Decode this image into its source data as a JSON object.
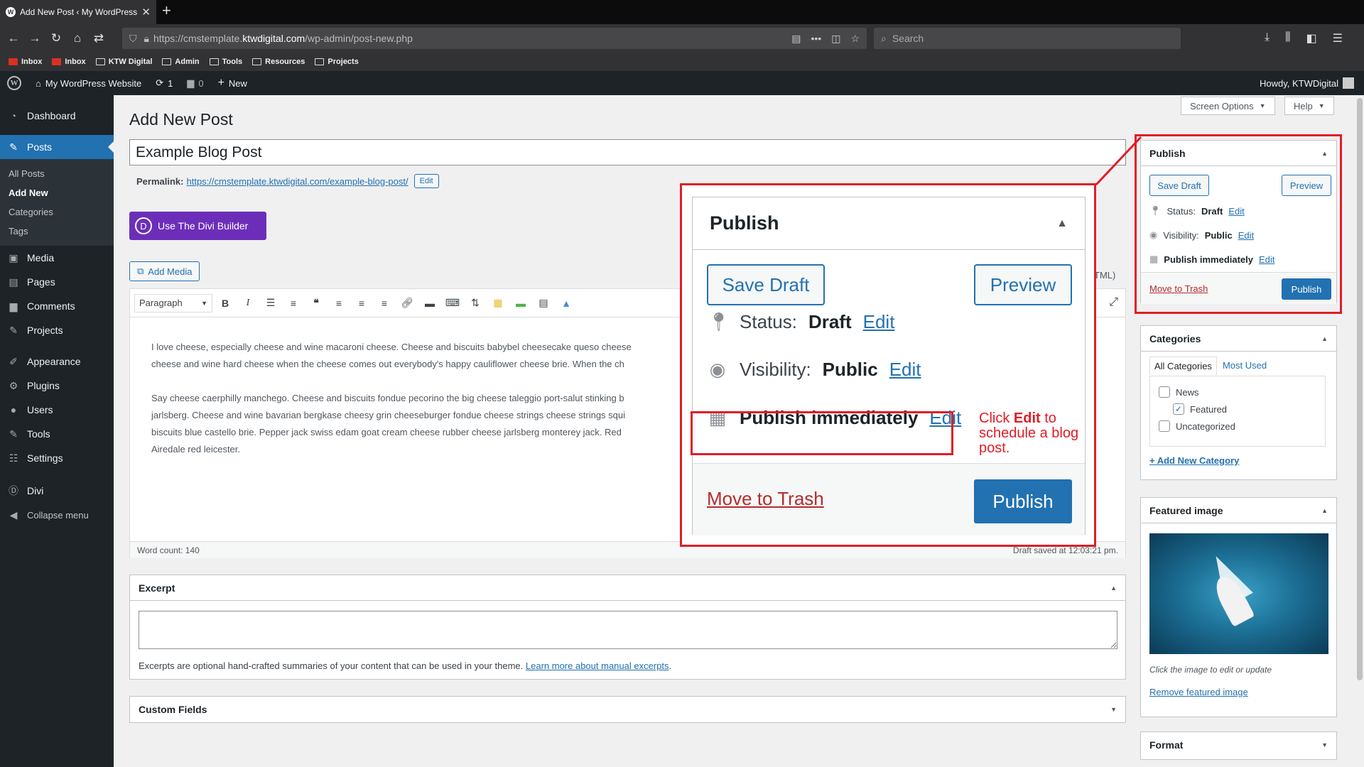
{
  "browser": {
    "tab_title": "Add New Post ‹ My WordPress",
    "url_prefix": "https://cmstemplate.",
    "url_host": "ktwdigital.com",
    "url_path": "/wp-admin/post-new.php",
    "search_placeholder": "Search",
    "bookmarks": [
      "Inbox",
      "Inbox",
      "KTW Digital",
      "Admin",
      "Tools",
      "Resources",
      "Projects"
    ]
  },
  "adminbar": {
    "site_name": "My WordPress Website",
    "updates": "1",
    "comments": "0",
    "new_label": "New",
    "howdy": "Howdy, KTWDigital"
  },
  "sidebar": {
    "dashboard": "Dashboard",
    "posts": "Posts",
    "posts_sub": [
      "All Posts",
      "Add New",
      "Categories",
      "Tags"
    ],
    "media": "Media",
    "pages": "Pages",
    "comments": "Comments",
    "projects": "Projects",
    "appearance": "Appearance",
    "plugins": "Plugins",
    "users": "Users",
    "tools": "Tools",
    "settings": "Settings",
    "divi": "Divi",
    "collapse": "Collapse menu"
  },
  "header": {
    "screen_options": "Screen Options",
    "help": "Help",
    "page_title": "Add New Post"
  },
  "post": {
    "title": "Example Blog Post",
    "permalink_label": "Permalink:",
    "permalink_url": "https://cmstemplate.ktwdigital.com/example-blog-post/",
    "permalink_edit": "Edit",
    "divi_button": "Use The Divi Builder",
    "add_media": "Add Media",
    "html_tab_fragment": "TML)",
    "format_select": "Paragraph",
    "paragraph1_line1": "I love cheese, especially cheese and wine macaroni cheese. Cheese and biscuits babybel cheesecake queso cheese",
    "paragraph1_line2": "cheese and wine hard cheese when the cheese comes out everybody's happy cauliflower cheese brie. When the ch",
    "paragraph2_line1": "Say cheese caerphilly manchego. Cheese and biscuits fondue pecorino the big cheese taleggio port-salut stinking b",
    "paragraph2_line2": "jarlsberg. Cheese and wine bavarian bergkase cheesy grin cheeseburger fondue cheese strings cheese strings squi",
    "paragraph2_line3": "biscuits blue castello brie. Pepper jack swiss edam goat cream cheese rubber cheese jarlsberg monterey jack. Red",
    "paragraph2_line4": "Airedale red leicester.",
    "word_count": "Word count: 140",
    "draft_saved": "Draft saved at 12:03:21 pm."
  },
  "excerpt": {
    "title": "Excerpt",
    "note": "Excerpts are optional hand-crafted summaries of your content that can be used in your theme.",
    "link": "Learn more about manual excerpts",
    "period": "."
  },
  "custom_fields": {
    "title": "Custom Fields"
  },
  "publish": {
    "title": "Publish",
    "save_draft": "Save Draft",
    "preview": "Preview",
    "status_label": "Status:",
    "status_value": "Draft",
    "visibility_label": "Visibility:",
    "visibility_value": "Public",
    "schedule_value": "Publish immediately",
    "edit": "Edit",
    "trash": "Move to Trash",
    "publish_button": "Publish"
  },
  "categories": {
    "title": "Categories",
    "tab_all": "All Categories",
    "tab_used": "Most Used",
    "items": [
      {
        "label": "News",
        "checked": false
      },
      {
        "label": "Featured",
        "checked": true
      },
      {
        "label": "Uncategorized",
        "checked": false
      }
    ],
    "add_new": "+ Add New Category"
  },
  "featured_image": {
    "title": "Featured image",
    "caption": "Click the image to edit or update",
    "remove": "Remove featured image"
  },
  "format": {
    "title": "Format"
  },
  "annotation": {
    "pre": "Click ",
    "bold": "Edit",
    "post": " to schedule a blog post."
  },
  "colors": {
    "accent": "#2271b1",
    "admin_dark": "#1d2327",
    "highlight_red": "#e11d26",
    "divi_purple": "#6c2eb9",
    "trash_red": "#b32d2e"
  }
}
